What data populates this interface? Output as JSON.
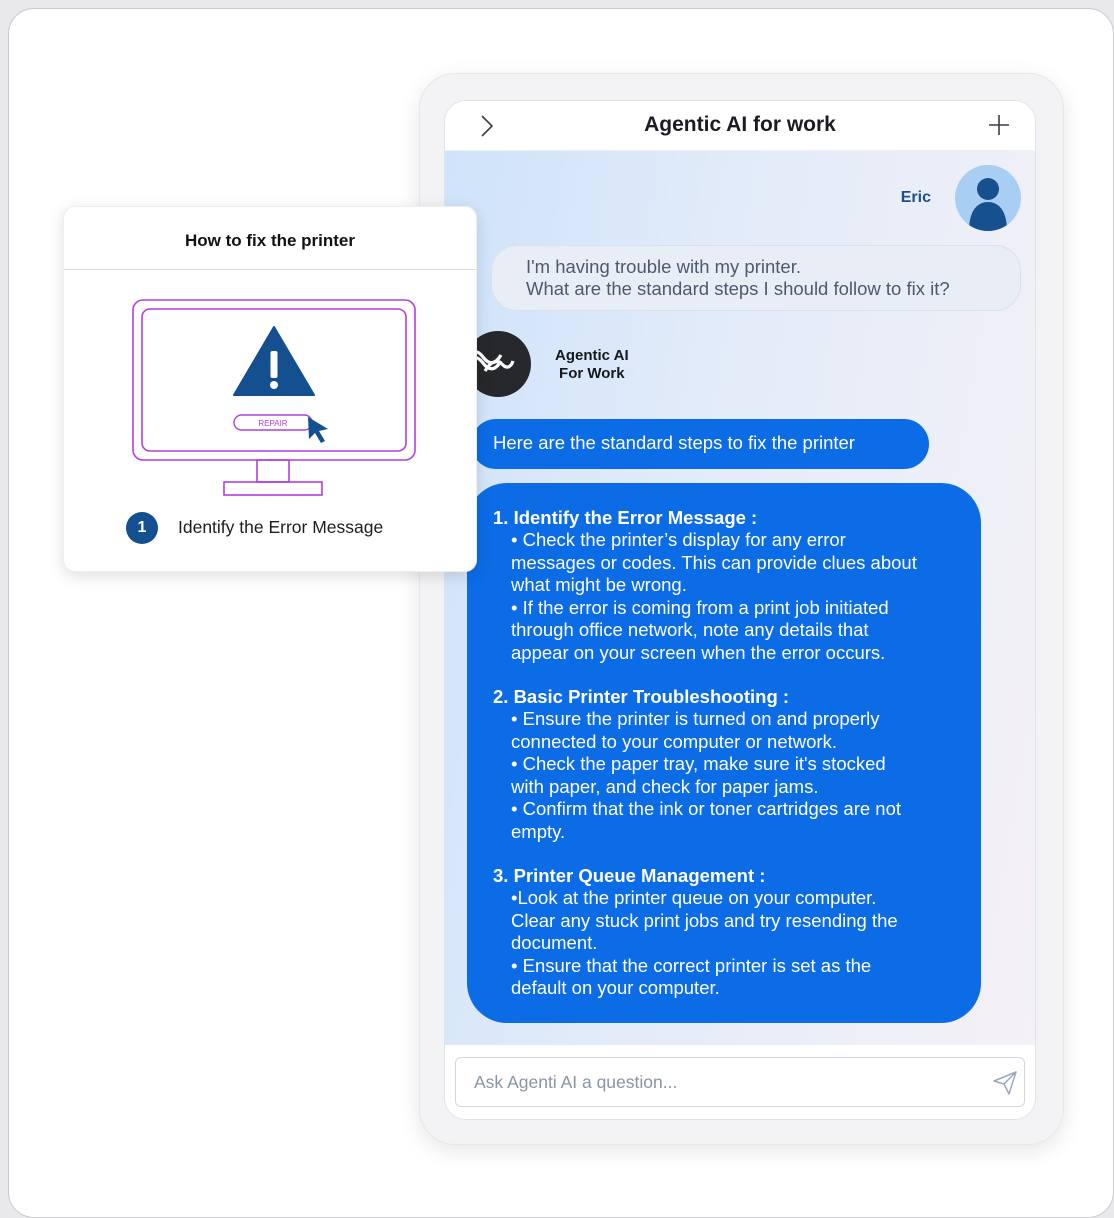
{
  "chat": {
    "title": "Agentic AI for work",
    "user": {
      "name": "Eric"
    },
    "user_message": [
      "I'm having trouble with my printer.",
      "What are the standard steps I should follow to fix it?"
    ],
    "bot": {
      "name_line1": "Agentic AI",
      "name_line2": "For Work"
    },
    "bot_intro": "Here are the standard steps to fix the printer",
    "steps": [
      {
        "title": "1. Identify the Error Message :",
        "lines": [
          "• Check the printer’s display for any error",
          "messages or codes. This can provide clues about",
          "what might be wrong.",
          "• If the error is coming from a print job initiated",
          "through office network, note any details that",
          "appear on your screen when the error occurs."
        ]
      },
      {
        "title": "2. Basic Printer Troubleshooting :",
        "lines": [
          "• Ensure the printer is turned on and properly",
          "connected to your computer or network.",
          "• Check the paper tray, make sure it's stocked",
          "with paper, and check for paper jams.",
          "• Confirm that the ink or toner cartridges are not",
          "empty."
        ]
      },
      {
        "title": "3. Printer Queue Management :",
        "lines": [
          "•Look at the printer queue on your computer.",
          "Clear any stuck print jobs and try resending the",
          "document.",
          "• Ensure that the correct printer is set as the",
          "default on your computer."
        ]
      }
    ],
    "input": {
      "placeholder": "Ask Agenti AI a question...",
      "value": ""
    },
    "icons": {
      "collapse": "chevron-right-icon",
      "new_chat": "plus-icon",
      "send": "send-icon",
      "user_avatar": "user-silhouette-icon",
      "bot_avatar": "agent-logo-icon"
    }
  },
  "help_card": {
    "title": "How to fix the printer",
    "illustration": {
      "button_label": "REPAIR",
      "icon": "warning-triangle-icon",
      "cursor": "mouse-pointer-icon"
    },
    "step": {
      "number": "1",
      "text": "Identify the Error Message"
    }
  },
  "colors": {
    "accent_blue": "#0b6ce6",
    "dark_blue": "#144f90",
    "monitor_outline": "#b23fe0",
    "user_name": "#1d4f8f"
  }
}
